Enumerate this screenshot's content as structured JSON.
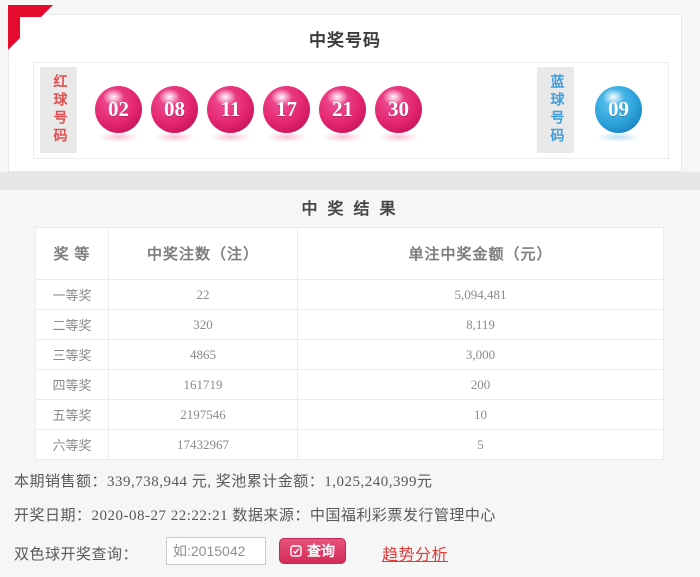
{
  "colors": {
    "red_ball": "#e4256f",
    "blue_ball": "#2da3dc",
    "ribbon_red": "#e40b2d",
    "button_red": "#d32c58",
    "link_red": "#e23b3b",
    "red_label_text": "#e05050",
    "blue_label_text": "#3f9fdc"
  },
  "header": {
    "title": "中奖号码"
  },
  "balls": {
    "red_label": "红球号码",
    "blue_label": "蓝球号码",
    "red": [
      "02",
      "08",
      "11",
      "17",
      "21",
      "30"
    ],
    "blue": [
      "09"
    ]
  },
  "results": {
    "title": "中 奖 结 果",
    "headers": [
      "奖 等",
      "中奖注数（注）",
      "单注中奖金额（元）"
    ],
    "rows": [
      [
        "一等奖",
        "22",
        "5,094,481"
      ],
      [
        "二等奖",
        "320",
        "8,119"
      ],
      [
        "三等奖",
        "4865",
        "3,000"
      ],
      [
        "四等奖",
        "161719",
        "200"
      ],
      [
        "五等奖",
        "2197546",
        "10"
      ],
      [
        "六等奖",
        "17432967",
        "5"
      ]
    ]
  },
  "footer": {
    "sales_line": "本期销售额：339,738,944 元, 奖池累计金额：1,025,240,399元",
    "draw_line": "开奖日期：2020-08-27 22:22:21 数据来源：中国福利彩票发行管理中心",
    "query_label": "双色球开奖查询：",
    "query_placeholder": "如:2015042",
    "query_button": "查询",
    "trend_link": "趋势分析"
  }
}
